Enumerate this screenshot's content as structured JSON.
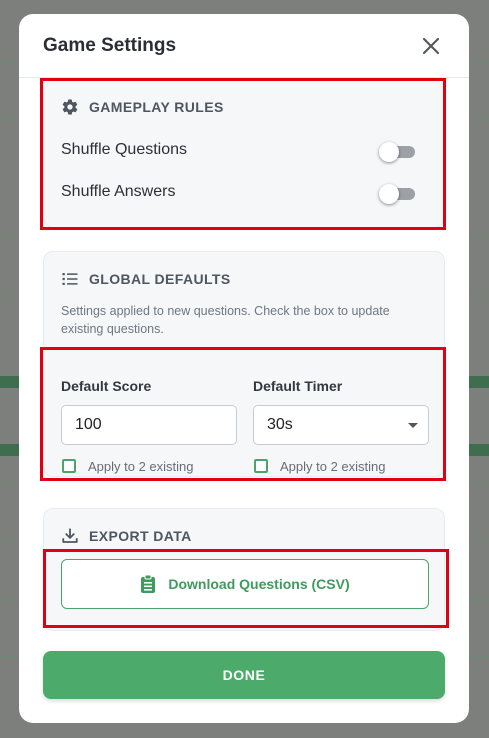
{
  "modal": {
    "title": "Game Settings"
  },
  "gameplay": {
    "title": "GAMEPLAY RULES",
    "shuffle_questions": {
      "label": "Shuffle Questions",
      "on": false
    },
    "shuffle_answers": {
      "label": "Shuffle Answers",
      "on": false
    }
  },
  "defaults": {
    "title": "GLOBAL DEFAULTS",
    "description": "Settings applied to new questions. Check the box to update existing questions.",
    "score": {
      "label": "Default Score",
      "value": "100",
      "apply_label": "Apply to 2 existing",
      "checked": false
    },
    "timer": {
      "label": "Default Timer",
      "value": "30s",
      "apply_label": "Apply to 2 existing",
      "checked": false
    }
  },
  "export": {
    "title": "EXPORT DATA",
    "download_label": "Download Questions (CSV)"
  },
  "footer": {
    "done_label": "DONE"
  },
  "colors": {
    "accent": "#4caa6a",
    "highlight": "#e00012"
  },
  "icons": [
    "close-icon",
    "gear-icon",
    "list-icon",
    "download-icon",
    "clipboard-icon"
  ]
}
